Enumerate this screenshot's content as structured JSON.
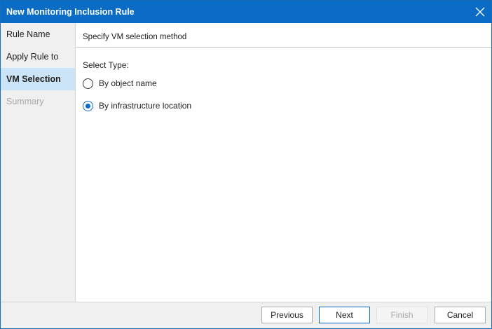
{
  "window": {
    "title": "New Monitoring Inclusion Rule",
    "close_icon": "close-icon"
  },
  "sidebar": {
    "items": [
      {
        "label": "Rule Name",
        "state": "normal"
      },
      {
        "label": "Apply Rule to",
        "state": "normal"
      },
      {
        "label": "VM Selection",
        "state": "active"
      },
      {
        "label": "Summary",
        "state": "disabled"
      }
    ]
  },
  "main": {
    "header": "Specify VM selection method",
    "select_type_label": "Select Type:",
    "options": [
      {
        "label": "By object name",
        "checked": false
      },
      {
        "label": "By infrastructure location",
        "checked": true
      }
    ]
  },
  "footer": {
    "previous": "Previous",
    "next": "Next",
    "finish": "Finish",
    "cancel": "Cancel"
  },
  "colors": {
    "accent": "#0a6cc5",
    "active_step_bg": "#cce4f7",
    "sidebar_bg": "#f0f0f0"
  }
}
